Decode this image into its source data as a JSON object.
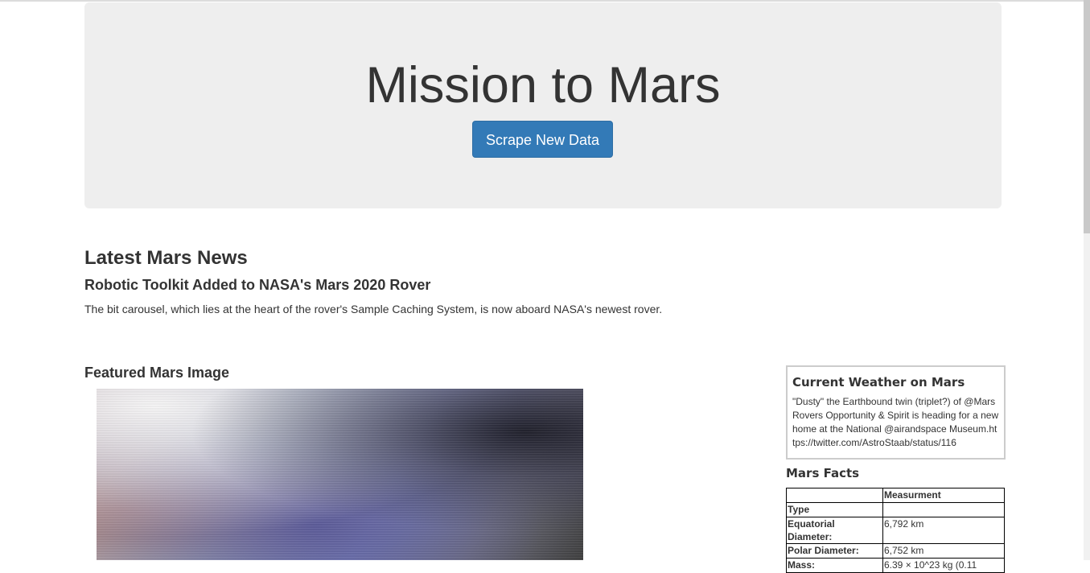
{
  "jumbotron": {
    "title": "Mission to Mars",
    "button_label": "Scrape New Data",
    "button_color": "#337ab7"
  },
  "news": {
    "heading": "Latest Mars News",
    "title": "Robotic Toolkit Added to NASA's Mars 2020 Rover",
    "paragraph": "The bit carousel, which lies at the heart of the rover's Sample Caching System, is now aboard NASA's newest rover."
  },
  "featured": {
    "heading": "Featured Mars Image"
  },
  "weather": {
    "heading": "Current Weather on Mars",
    "text": "\"Dusty\" the Earthbound twin (triplet?) of @MarsRovers Opportunity & Spirit is heading for a new home at the National @airandspace Museum.https://twitter.com/AstroStaab/status/116"
  },
  "facts": {
    "heading": "Mars Facts",
    "header_blank": "",
    "header_measurement": "Measurment",
    "rows": [
      {
        "label": "Type",
        "value": ""
      },
      {
        "label": "Equatorial Diameter:",
        "value": "6,792 km"
      },
      {
        "label": "Polar Diameter:",
        "value": "6,752 km"
      },
      {
        "label": "Mass:",
        "value": "6.39 × 10^23 kg (0.11"
      }
    ]
  }
}
